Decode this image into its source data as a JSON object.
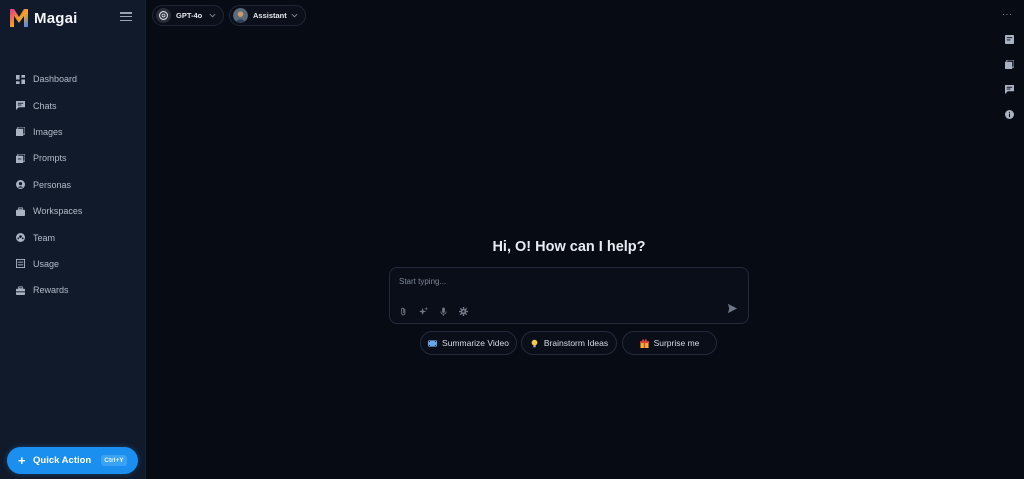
{
  "app": {
    "name": "Magai",
    "brand_colors": {
      "magenta": "#e2338f",
      "orange": "#f5a524",
      "blue": "#3b82f6",
      "accent": "#1a8ff0"
    }
  },
  "sidebar": {
    "items": [
      {
        "label": "Dashboard",
        "icon": "dashboard-icon"
      },
      {
        "label": "Chats",
        "icon": "chat-icon"
      },
      {
        "label": "Images",
        "icon": "images-icon"
      },
      {
        "label": "Prompts",
        "icon": "prompts-icon"
      },
      {
        "label": "Personas",
        "icon": "persona-icon"
      },
      {
        "label": "Workspaces",
        "icon": "briefcase-icon"
      },
      {
        "label": "Team",
        "icon": "team-icon"
      },
      {
        "label": "Usage",
        "icon": "usage-icon"
      },
      {
        "label": "Rewards",
        "icon": "gift-icon"
      }
    ],
    "quick_action": {
      "label": "Quick Action",
      "shortcut": "Ctrl+Y"
    }
  },
  "topbar": {
    "model": {
      "label": "GPT-4o",
      "icon": "openai-icon"
    },
    "persona": {
      "label": "Assistant",
      "icon": "avatar"
    }
  },
  "right_toolbar": [
    "notes-icon",
    "library-icon",
    "comment-icon",
    "info-icon"
  ],
  "main": {
    "greeting": "Hi, O! How can I help?",
    "composer": {
      "placeholder": "Start typing...",
      "tools": [
        "attach-icon",
        "sparkle-icon",
        "mic-icon",
        "settings-icon"
      ]
    },
    "suggestions": [
      {
        "label": "Summarize Video",
        "emoji": "🎞️"
      },
      {
        "label": "Brainstorm Ideas",
        "emoji": "💡"
      },
      {
        "label": "Surprise me",
        "emoji": "🎁"
      }
    ]
  }
}
